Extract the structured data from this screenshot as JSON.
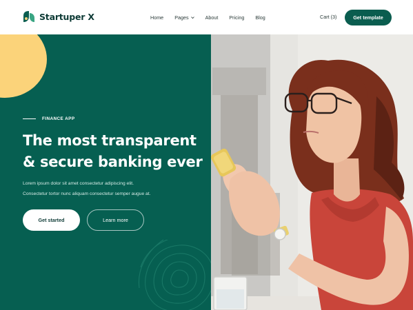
{
  "brand": {
    "name": "Startuper X",
    "logo_icon": "leaf-logo-icon"
  },
  "nav": {
    "items": [
      {
        "label": "Home",
        "has_dropdown": false
      },
      {
        "label": "Pages",
        "has_dropdown": true
      },
      {
        "label": "About",
        "has_dropdown": false
      },
      {
        "label": "Pricing",
        "has_dropdown": false
      },
      {
        "label": "Blog",
        "has_dropdown": false
      }
    ],
    "cart_label": "Cart",
    "cart_count": "(3)",
    "cta_label": "Get template"
  },
  "hero": {
    "eyebrow": "FINANCE APP",
    "headline_line1": "The most transparent",
    "headline_line2": "& secure banking ever",
    "description_line1": "Lorem ipsum dolor sit amet consectetur adipiscing elit.",
    "description_line2": "Consectetur tortor nunc aliquam consectetur semper augue at.",
    "primary_button": "Get started",
    "secondary_button": "Learn more"
  },
  "colors": {
    "brand_green": "#065f51",
    "button_green": "#0a5d4f",
    "accent_yellow": "#fbd37a",
    "shirt_red": "#c9453a",
    "text_dark": "#0e3b36"
  }
}
